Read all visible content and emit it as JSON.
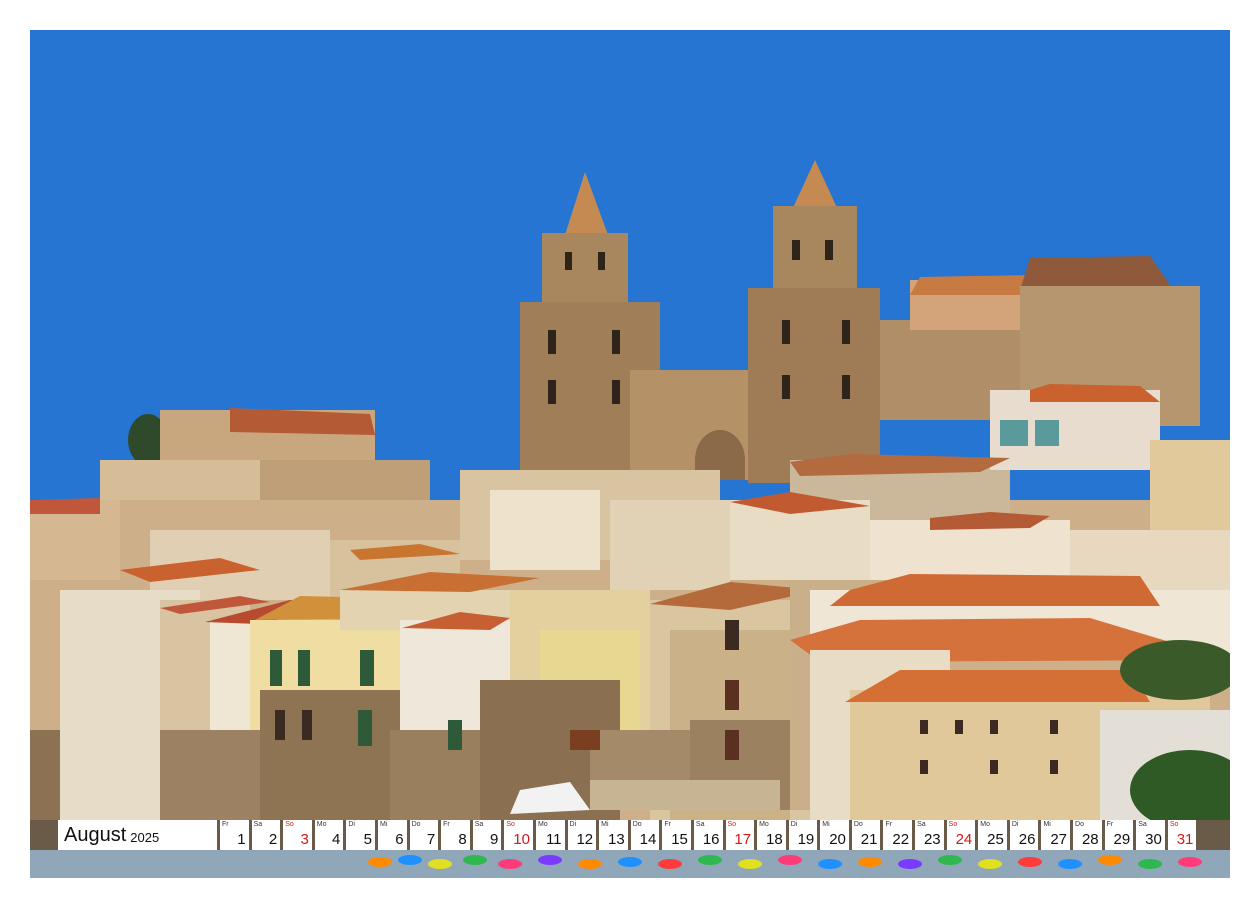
{
  "calendar": {
    "month": "August",
    "year": "2025",
    "sunday_color": "#d11919",
    "days": [
      {
        "abbr": "Fr",
        "num": "1",
        "sunday": false
      },
      {
        "abbr": "Sa",
        "num": "2",
        "sunday": false
      },
      {
        "abbr": "So",
        "num": "3",
        "sunday": true
      },
      {
        "abbr": "Mo",
        "num": "4",
        "sunday": false
      },
      {
        "abbr": "Di",
        "num": "5",
        "sunday": false
      },
      {
        "abbr": "Mi",
        "num": "6",
        "sunday": false
      },
      {
        "abbr": "Do",
        "num": "7",
        "sunday": false
      },
      {
        "abbr": "Fr",
        "num": "8",
        "sunday": false
      },
      {
        "abbr": "Sa",
        "num": "9",
        "sunday": false
      },
      {
        "abbr": "So",
        "num": "10",
        "sunday": true
      },
      {
        "abbr": "Mo",
        "num": "11",
        "sunday": false
      },
      {
        "abbr": "Di",
        "num": "12",
        "sunday": false
      },
      {
        "abbr": "Mi",
        "num": "13",
        "sunday": false
      },
      {
        "abbr": "Do",
        "num": "14",
        "sunday": false
      },
      {
        "abbr": "Fr",
        "num": "15",
        "sunday": false
      },
      {
        "abbr": "Sa",
        "num": "16",
        "sunday": false
      },
      {
        "abbr": "So",
        "num": "17",
        "sunday": true
      },
      {
        "abbr": "Mo",
        "num": "18",
        "sunday": false
      },
      {
        "abbr": "Di",
        "num": "19",
        "sunday": false
      },
      {
        "abbr": "Mi",
        "num": "20",
        "sunday": false
      },
      {
        "abbr": "Do",
        "num": "21",
        "sunday": false
      },
      {
        "abbr": "Fr",
        "num": "22",
        "sunday": false
      },
      {
        "abbr": "Sa",
        "num": "23",
        "sunday": false
      },
      {
        "abbr": "So",
        "num": "24",
        "sunday": true
      },
      {
        "abbr": "Mo",
        "num": "25",
        "sunday": false
      },
      {
        "abbr": "Di",
        "num": "26",
        "sunday": false
      },
      {
        "abbr": "Mi",
        "num": "27",
        "sunday": false
      },
      {
        "abbr": "Do",
        "num": "28",
        "sunday": false
      },
      {
        "abbr": "Fr",
        "num": "29",
        "sunday": false
      },
      {
        "abbr": "Sa",
        "num": "30",
        "sunday": false
      },
      {
        "abbr": "So",
        "num": "31",
        "sunday": true
      }
    ]
  },
  "photo": {
    "sky_color": "#1f6fd0",
    "stone_color": "#a8865e",
    "roof_color": "#c9622f",
    "wall_color": "#e6d2ad"
  }
}
